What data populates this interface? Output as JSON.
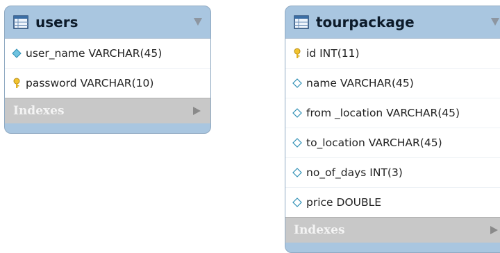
{
  "entities": [
    {
      "name": "users",
      "columns": [
        {
          "key": "diamond-icon",
          "text": "user_name VARCHAR(45)"
        },
        {
          "key": "key-icon",
          "text": "password VARCHAR(10)"
        }
      ],
      "indexes_label": "Indexes"
    },
    {
      "name": "tourpackage",
      "columns": [
        {
          "key": "key-icon",
          "text": "id INT(11)"
        },
        {
          "key": "diamond-icon",
          "text": "name VARCHAR(45)"
        },
        {
          "key": "diamond-icon",
          "text": "from _location VARCHAR(45)"
        },
        {
          "key": "diamond-icon",
          "text": "to_location VARCHAR(45)"
        },
        {
          "key": "diamond-icon",
          "text": "no_of_days INT(3)"
        },
        {
          "key": "diamond-icon",
          "text": "price DOUBLE"
        }
      ],
      "indexes_label": "Indexes"
    }
  ],
  "colors": {
    "header_bg": "#a9c6e0",
    "indexes_bg": "#c8c8c8",
    "key_icon": "#f2c32e",
    "diamond_icon": "#6fc3e0"
  }
}
